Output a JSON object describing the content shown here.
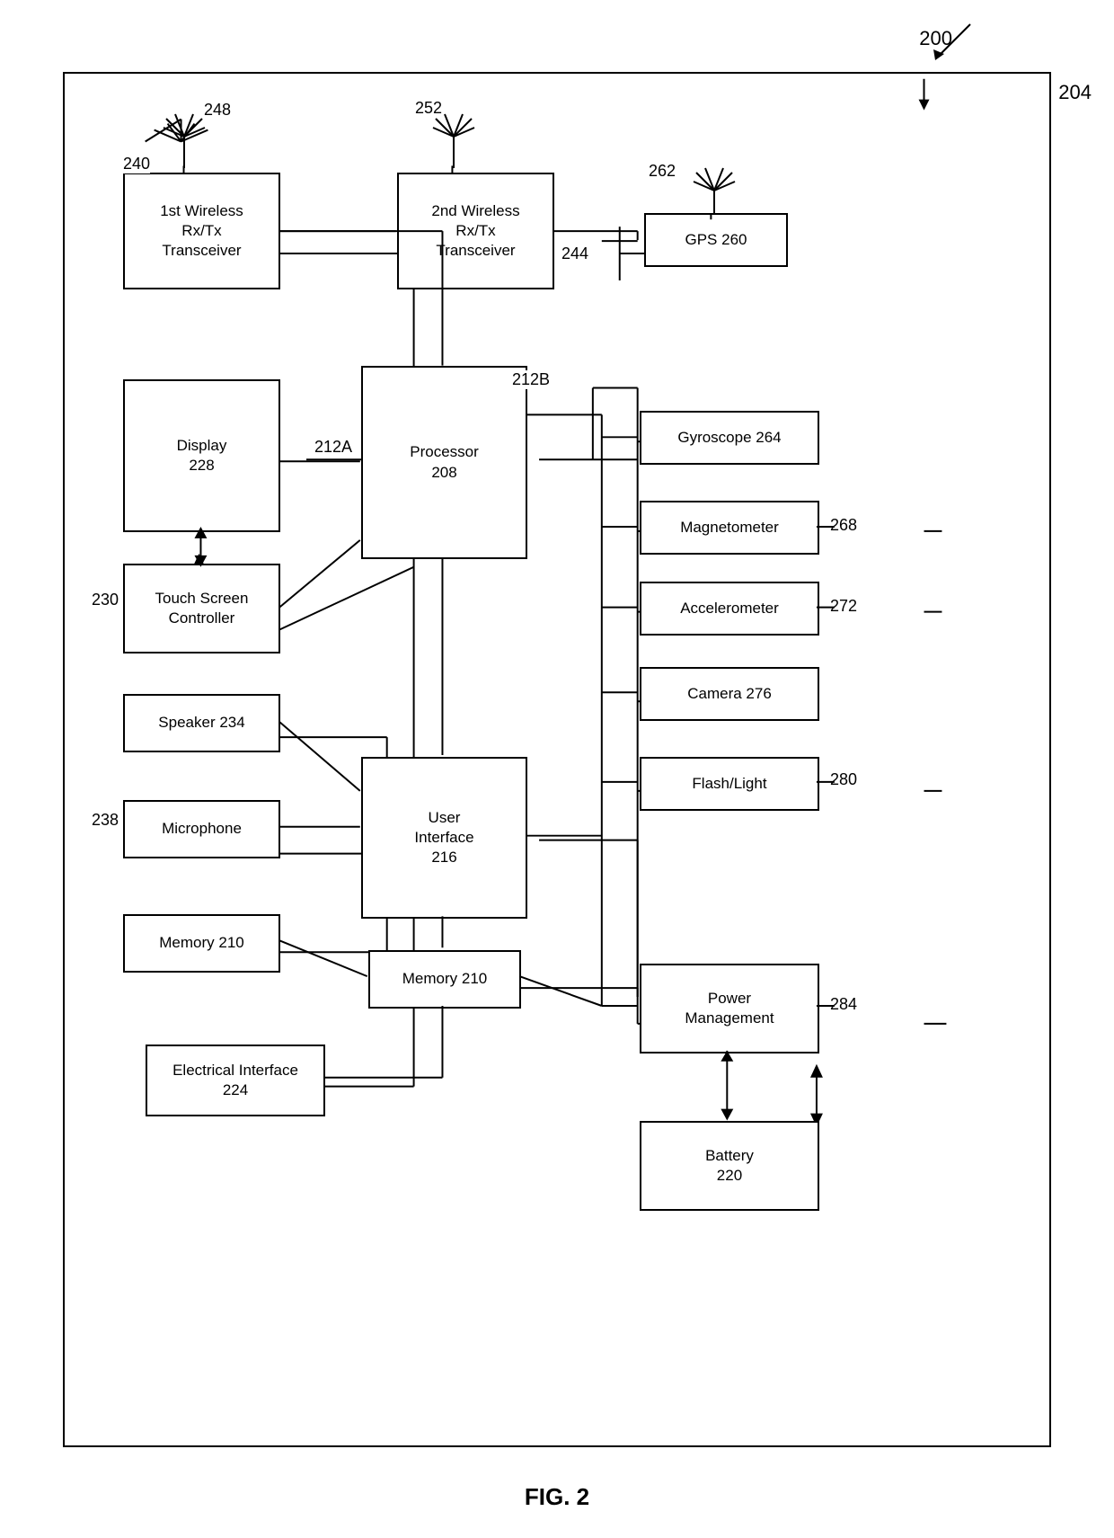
{
  "diagram": {
    "top_label": "200",
    "fig_label": "204",
    "fig_caption": "FIG. 2",
    "components": {
      "wireless1": {
        "label": "1st Wireless\nRx/Tx\nTransceiver",
        "ref": "240"
      },
      "wireless2": {
        "label": "2nd Wireless\nRx/Tx\nTransceiver",
        "ref": "252"
      },
      "gps": {
        "label": "GPS 260",
        "ref": "262"
      },
      "display": {
        "label": "Display\n228"
      },
      "touch_screen": {
        "label": "Touch Screen\nController",
        "ref": "230"
      },
      "speaker": {
        "label": "Speaker 234"
      },
      "microphone": {
        "label": "Microphone",
        "ref": "238"
      },
      "memory_left": {
        "label": "Memory 210"
      },
      "electrical": {
        "label": "Electrical Interface\n224"
      },
      "processor": {
        "label": "Processor\n208",
        "ref_a": "212A",
        "ref_b": "212B"
      },
      "user_interface": {
        "label": "User\nInterface\n216"
      },
      "memory_center": {
        "label": "Memory 210"
      },
      "gyroscope": {
        "label": "Gyroscope 264"
      },
      "magnetometer": {
        "label": "Magnetometer",
        "ref": "268"
      },
      "accelerometer": {
        "label": "Accelerometer",
        "ref": "272"
      },
      "camera": {
        "label": "Camera 276"
      },
      "flash": {
        "label": "Flash/Light",
        "ref": "280"
      },
      "power_mgmt": {
        "label": "Power\nManagement",
        "ref": "284"
      },
      "battery": {
        "label": "Battery\n220"
      }
    },
    "refs": {
      "ant1": "248",
      "ant2_main": "252",
      "ant2_label": "244",
      "gps_ant": "262"
    }
  }
}
